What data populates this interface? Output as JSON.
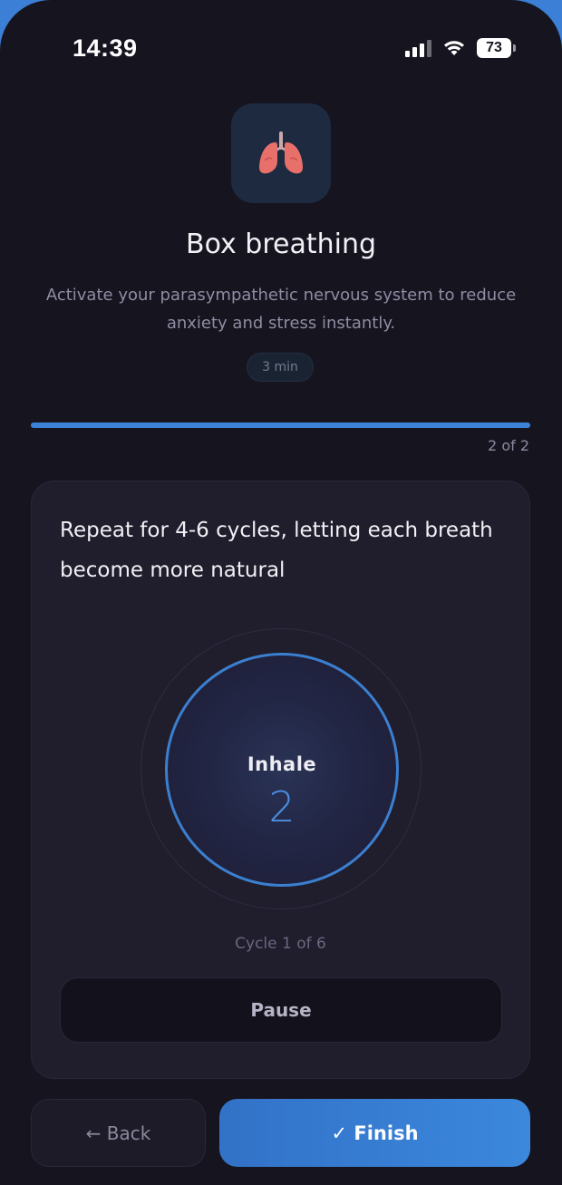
{
  "status_bar": {
    "time": "14:39",
    "battery": "73"
  },
  "header": {
    "icon": "lungs-icon",
    "title": "Box breathing",
    "subtitle": "Activate your parasympathetic nervous system to reduce anxiety and stress instantly.",
    "duration": "3 min"
  },
  "progress": {
    "fraction": 1.0,
    "label": "2 of 2"
  },
  "card": {
    "instruction": "Repeat for 4-6 cycles, letting each breath become more natural",
    "phase": "Inhale",
    "count": "2",
    "cycle": "Cycle 1 of 6",
    "pause_label": "Pause"
  },
  "footer": {
    "back_label": "← Back",
    "finish_label": "✓ Finish"
  },
  "colors": {
    "accent": "#3b83d8",
    "background": "#16141f",
    "card": "#201d2c"
  }
}
